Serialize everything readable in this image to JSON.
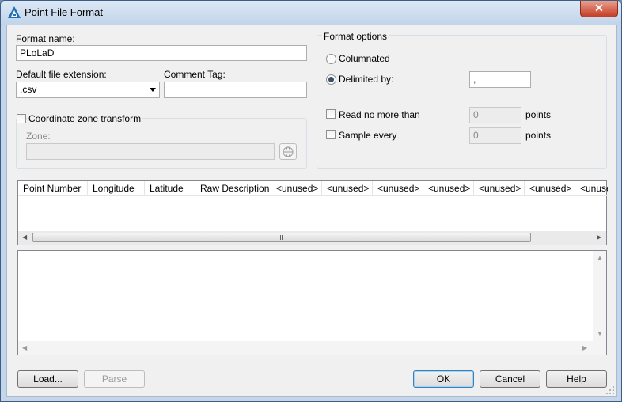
{
  "window": {
    "title": "Point File Format",
    "close_glyph": "✕"
  },
  "format_name": {
    "label": "Format name:",
    "value": "PLoLaD"
  },
  "extension": {
    "label": "Default file extension:",
    "value": ".csv"
  },
  "comment_tag": {
    "label": "Comment Tag:",
    "value": ""
  },
  "coord_zone": {
    "label": "Coordinate zone transform",
    "checked": false,
    "zone_label": "Zone:",
    "zone_value": ""
  },
  "format_options": {
    "legend": "Format options",
    "columnated": "Columnated",
    "delimited": "Delimited by:",
    "delimiter_value": ",",
    "read_no_more": "Read no more than",
    "read_value": "0",
    "read_unit": "points",
    "sample_every": "Sample every",
    "sample_value": "0",
    "sample_unit": "points"
  },
  "columns": [
    "Point Number",
    "Longitude",
    "Latitude",
    "Raw Description",
    "<unused>",
    "<unused>",
    "<unused>",
    "<unused>",
    "<unused>",
    "<unused>",
    "<unuse"
  ],
  "buttons": {
    "load": "Load...",
    "parse": "Parse",
    "ok": "OK",
    "cancel": "Cancel",
    "help": "Help"
  },
  "colors": {
    "window_frame": "#c5d6ea",
    "client": "#f0f0f0",
    "close": "#c43d25"
  }
}
